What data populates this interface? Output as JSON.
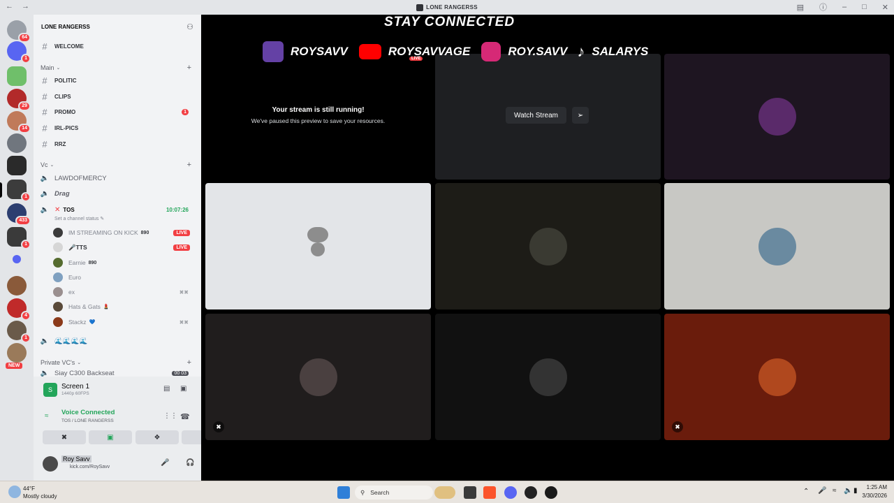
{
  "window": {
    "title": "LONE RANGERSS"
  },
  "server": {
    "name": "LONE RANGERSS"
  },
  "rail_badges": [
    "64",
    "1",
    "29",
    "14",
    "1",
    "433",
    "1",
    "1",
    "4",
    "1",
    "NEW"
  ],
  "categories": {
    "main": "Main",
    "vc": "Vc",
    "private": "Private VC's"
  },
  "text_channels": [
    {
      "name": "WELCOME",
      "badge": ""
    },
    {
      "name": "POLITIC",
      "badge": ""
    },
    {
      "name": "CLIPS",
      "badge": ""
    },
    {
      "name": "PROMO",
      "badge": "1"
    },
    {
      "name": "IRL-PICS",
      "badge": ""
    },
    {
      "name": "RRZ",
      "badge": ""
    }
  ],
  "voice_channels": {
    "lawd": "LAWDOFMERCY",
    "drag": "Drag",
    "tos": "TOS",
    "tos_timer": "10:07:26",
    "tos_status": "Set a channel status",
    "emoji_channel": "🌊🌊🌊🌊",
    "private_first": "Siay C300 Backseat",
    "private_count": "00 03"
  },
  "members": [
    {
      "name": "IM STREAMING ON KICK",
      "tag": "890",
      "live": "LIVE",
      "color": "#3b3b3b"
    },
    {
      "name": "🎤TTS",
      "tag": "",
      "live": "LIVE",
      "color": "#e6e6e6"
    },
    {
      "name": "Earnie",
      "tag": "890",
      "live": "",
      "color": "#556b2f"
    },
    {
      "name": "Euro",
      "tag": "",
      "live": "",
      "color": "#7fa0c0"
    },
    {
      "name": "ex",
      "tag": "",
      "live": "",
      "color": "#9a8f8f"
    },
    {
      "name": "Hats & Gats",
      "tag": "💄",
      "live": "",
      "color": "#5a4a3a"
    },
    {
      "name": "Stackz",
      "tag": "💙",
      "live": "",
      "color": "#8b3a1a"
    }
  ],
  "panel": {
    "screen_title": "Screen 1",
    "screen_sub": "1440p 60FPS",
    "voice_connected": "Voice Connected",
    "voice_sub": "TOS / LONE RANGERSS",
    "user_name": "Roy Savv",
    "user_status": "kick.com/RoySavv"
  },
  "overlay": {
    "heading": "STAY CONNECTED",
    "handles": [
      "ROYSAVV",
      "ROYSAVVAGE",
      "ROY.SAVV",
      "SALARYS"
    ]
  },
  "stage": {
    "paused_title": "Your stream is still running!",
    "paused_sub": "We've paused this preview to save your resources.",
    "watch_stream": "Watch Stream",
    "live_label": "LIVE"
  },
  "taskbar": {
    "temp": "44°F",
    "weather": "Mostly cloudy",
    "search": "Search",
    "time": "1:25 AM",
    "date": "3/30/2026"
  },
  "colors": {
    "live": "#f23f43",
    "green": "#23a55a",
    "blurple": "#5865f2"
  }
}
